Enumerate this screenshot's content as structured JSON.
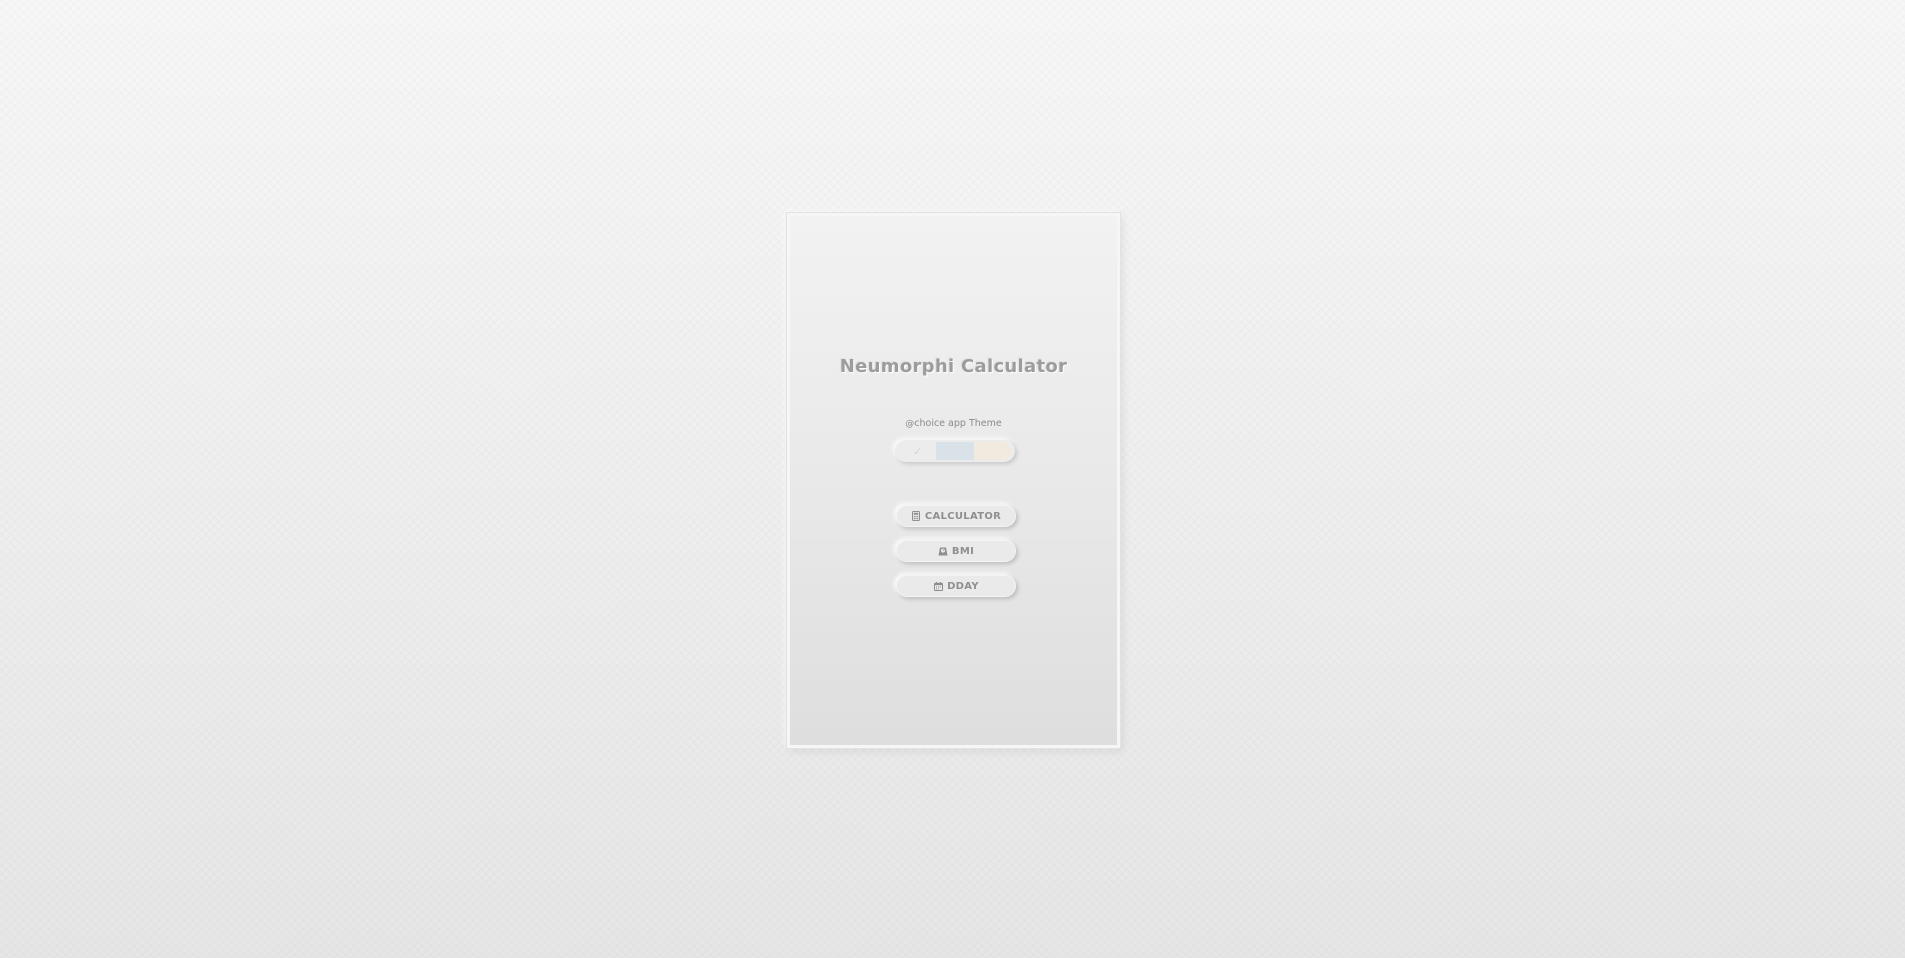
{
  "app": {
    "title": "Neumorphi Calculator"
  },
  "theme": {
    "label": "choice app Theme",
    "label_icon": "at-icon",
    "options": [
      {
        "name": "light",
        "color": "#ececec",
        "selected": true
      },
      {
        "name": "blue",
        "color": "#d9e1e9",
        "selected": false
      },
      {
        "name": "cream",
        "color": "#f1ebdf",
        "selected": false
      }
    ],
    "selected_mark": "✓"
  },
  "menu": {
    "items": [
      {
        "label": "CALCULATOR",
        "icon": "calculator-icon"
      },
      {
        "label": "BMI",
        "icon": "scale-icon"
      },
      {
        "label": "DDAY",
        "icon": "calendar-icon"
      }
    ]
  },
  "colors": {
    "text": "#8f8f8f",
    "title": "#9c9c9c",
    "card": "#e8e8e8"
  }
}
